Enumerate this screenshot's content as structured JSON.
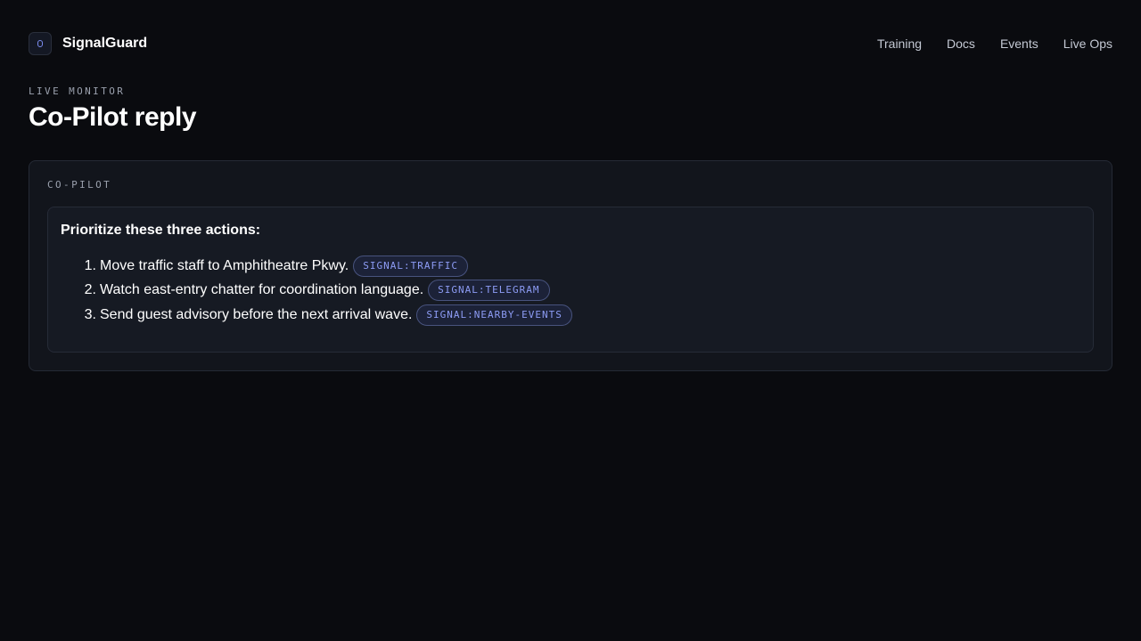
{
  "brand": {
    "name": "SignalGuard",
    "logo_icon": "shield-icon"
  },
  "nav": {
    "items": [
      {
        "label": "Training"
      },
      {
        "label": "Docs"
      },
      {
        "label": "Events"
      },
      {
        "label": "Live Ops"
      }
    ]
  },
  "page": {
    "eyebrow": "LIVE MONITOR",
    "title": "Co-Pilot reply"
  },
  "copilot": {
    "label": "CO-PILOT",
    "heading": "Prioritize these three actions:",
    "actions": [
      {
        "number": "1.",
        "text": "Move traffic staff to Amphitheatre Pkwy.",
        "tag": "SIGNAL:TRAFFIC"
      },
      {
        "number": "2.",
        "text": "Watch east-entry chatter for coordination language.",
        "tag": "SIGNAL:TELEGRAM"
      },
      {
        "number": "3.",
        "text": "Send guest advisory before the next arrival wave.",
        "tag": "SIGNAL:NEARBY-EVENTS"
      }
    ]
  },
  "colors": {
    "background": "#0a0b0f",
    "panel": "#12151c",
    "accent": "#8d9cf5"
  }
}
